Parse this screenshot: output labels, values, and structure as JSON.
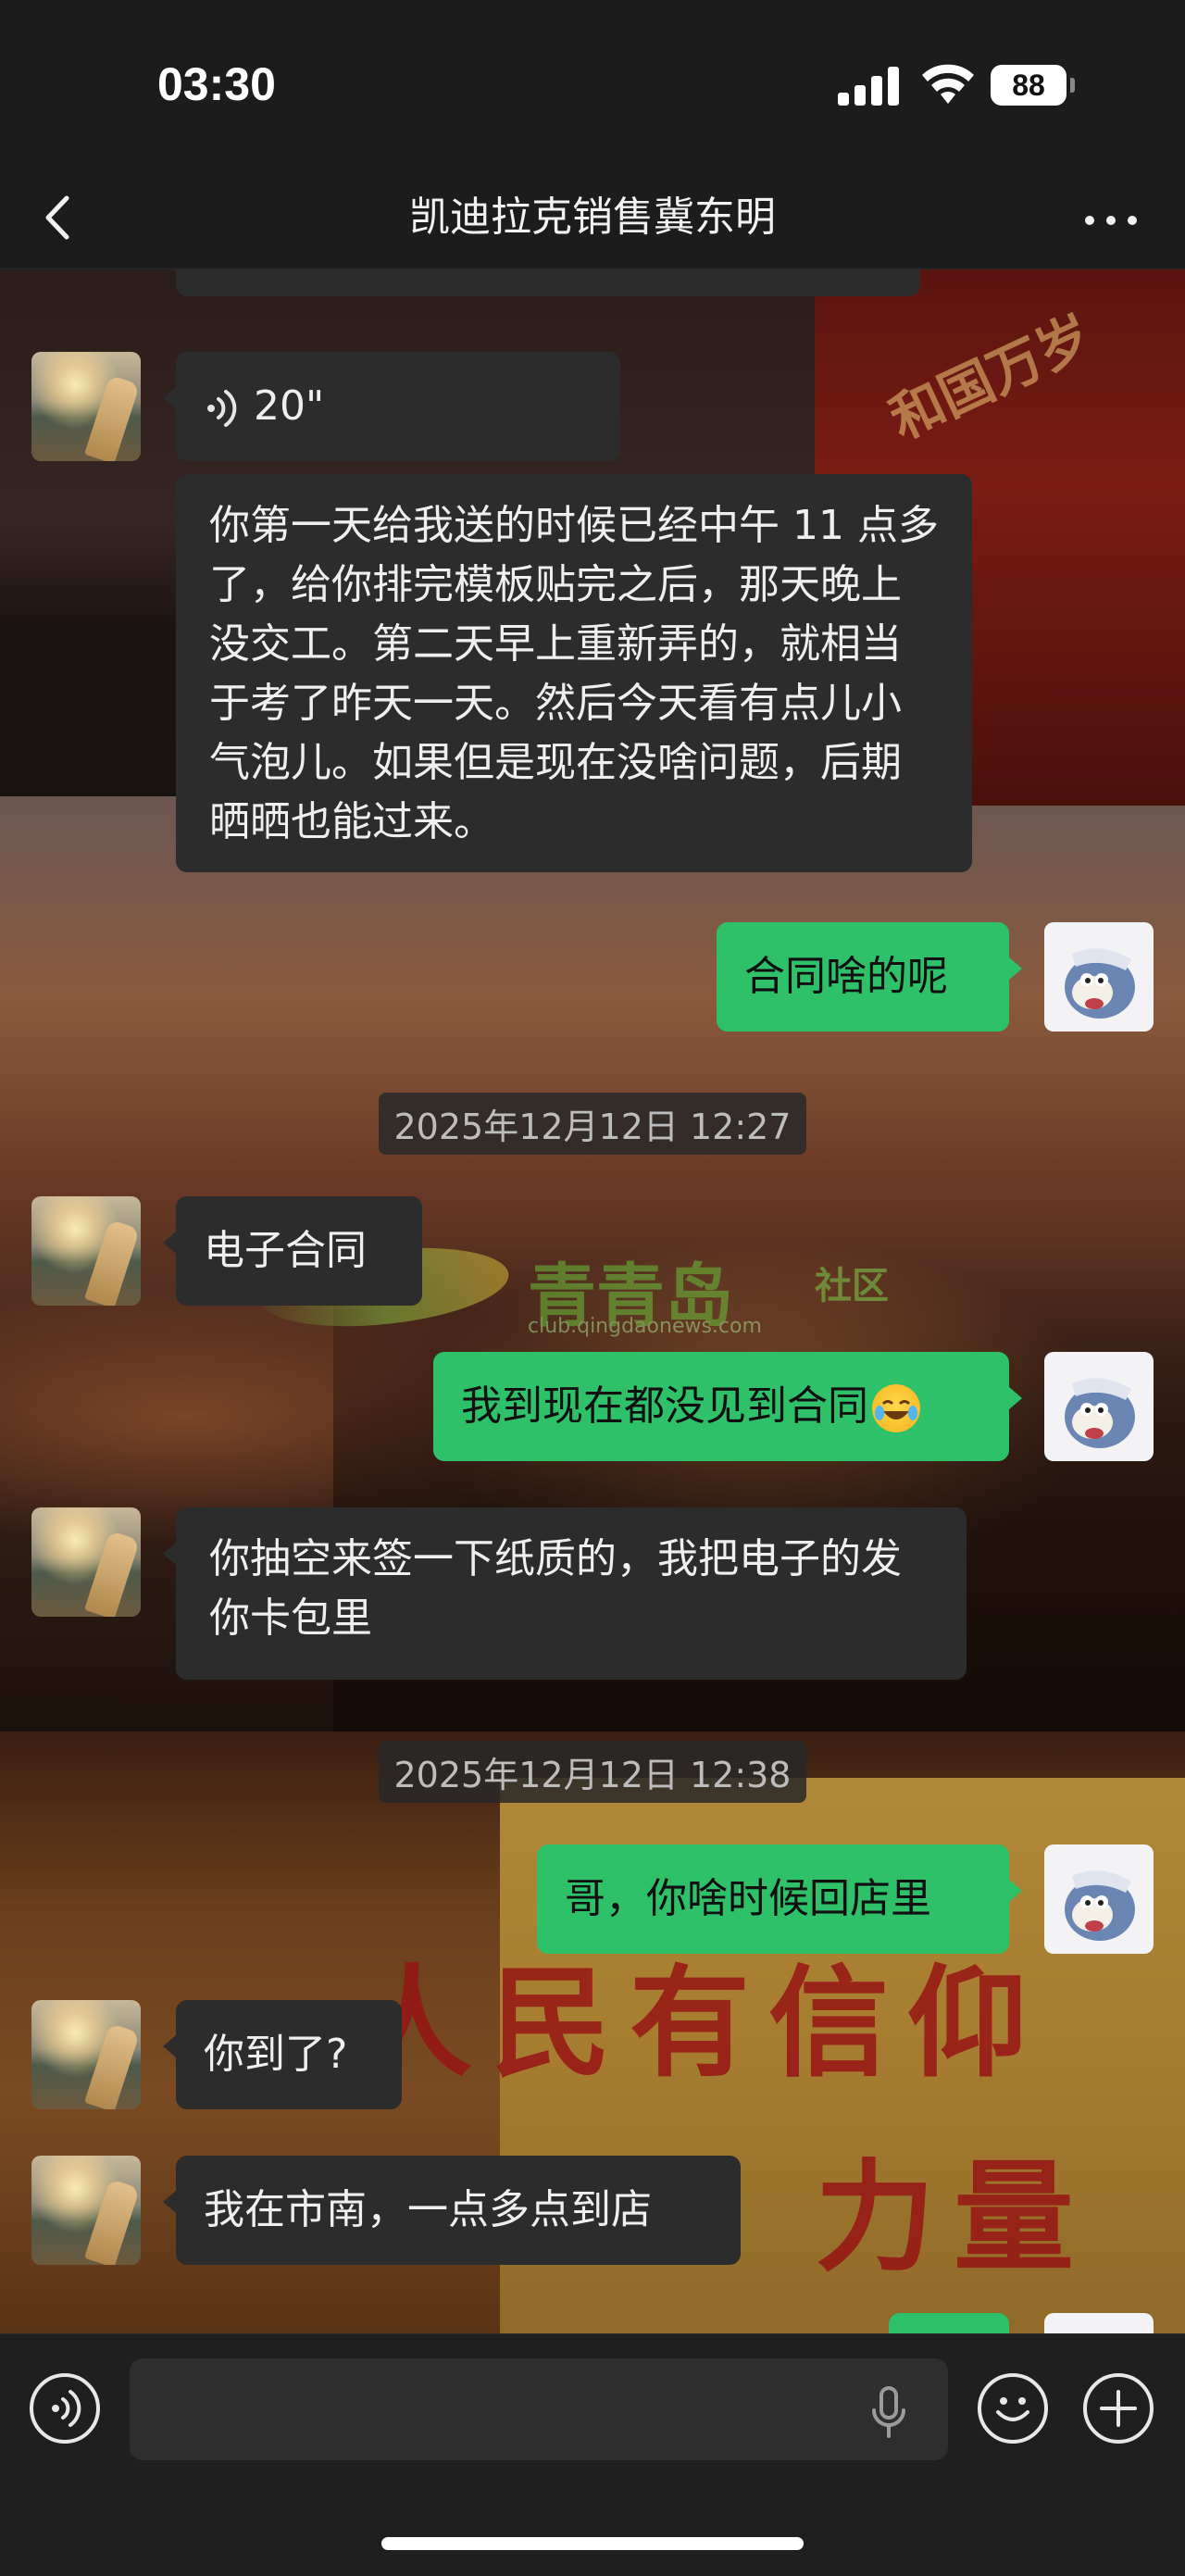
{
  "status_bar": {
    "time": "03:30",
    "battery": "88"
  },
  "nav": {
    "title": "凯迪拉克销售冀东明"
  },
  "messages": {
    "voice_duration": "20\"",
    "m1": "你第一天给我送的时候已经中午 11 点多了，给你排完模板贴完之后，那天晚上没交工。第二天早上重新弄的，就相当于考了昨天一天。然后今天看有点儿小气泡儿。如果但是现在没啥问题，后期晒晒也能过来。",
    "m2": "合同啥的呢",
    "ts1": "2025年12月12日 12:27",
    "m3": "电子合同",
    "m4": "我到现在都没见到合同",
    "m5": "你抽空来签一下纸质的，我把电子的发你卡包里",
    "ts2": "2025年12月12日 12:38",
    "m6": "哥，你啥时候回店里",
    "m7": "你到了?",
    "m8": "我在市南，一点多点到店"
  },
  "watermark": {
    "name": "青青岛",
    "suffix": "社区",
    "url": "club.qingdaonews.com"
  },
  "background_text": {
    "tower": "和国万岁",
    "wall_line1": "人民有信仰",
    "wall_line2": "力量"
  },
  "colors": {
    "my_bubble": "#2fc16a",
    "their_bubble": "#2c2c2c",
    "bar": "#1c1c1c"
  },
  "icons": {
    "back": "chevron-left-icon",
    "more": "more-dots-icon",
    "voice": "voice-wave-icon",
    "mic": "microphone-icon",
    "emoji": "emoji-icon",
    "add": "plus-icon"
  }
}
